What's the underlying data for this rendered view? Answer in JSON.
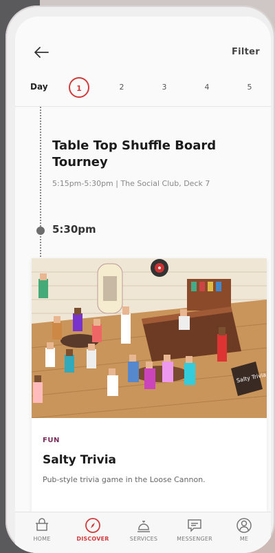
{
  "header": {
    "filter_label": "Filter"
  },
  "days": {
    "label": "Day",
    "items": [
      "1",
      "2",
      "3",
      "4",
      "5"
    ],
    "active": "1"
  },
  "event": {
    "title": "Table Top Shuffle Board Tourney",
    "meta": "5:15pm-5:30pm  |  The Social Club, Deck 7"
  },
  "timeslot": {
    "time": "5:30pm"
  },
  "card": {
    "tag": "FUN",
    "title": "Salty Trivia",
    "description": "Pub-style trivia game in the Loose Cannon.",
    "sign_text": "Salty Trivia"
  },
  "tabbar": {
    "items": [
      {
        "label": "HOME",
        "icon": "home-icon"
      },
      {
        "label": "DISCOVER",
        "icon": "compass-icon"
      },
      {
        "label": "SERVICES",
        "icon": "service-bell-icon"
      },
      {
        "label": "MESSENGER",
        "icon": "chat-icon"
      },
      {
        "label": "ME",
        "icon": "profile-icon"
      }
    ],
    "active": "DISCOVER"
  },
  "colors": {
    "accent": "#d33a3a",
    "tag": "#7a2b5a"
  }
}
